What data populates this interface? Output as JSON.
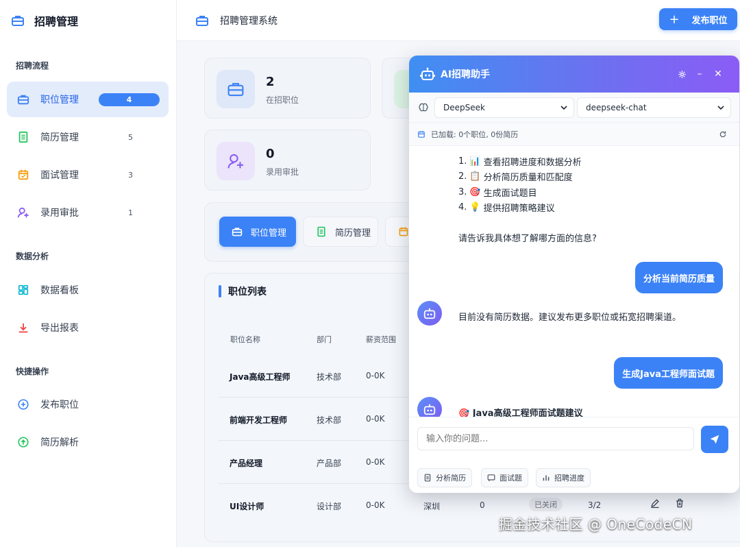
{
  "sidebar": {
    "brand": "招聘管理",
    "sections": [
      {
        "title": "招聘流程",
        "items": [
          {
            "label": "职位管理",
            "count": "4",
            "icon": "briefcase-icon"
          },
          {
            "label": "简历管理",
            "count": "5",
            "icon": "document-icon"
          },
          {
            "label": "面试管理",
            "count": "3",
            "icon": "calendar-icon"
          },
          {
            "label": "录用审批",
            "count": "1",
            "icon": "user-add-icon"
          }
        ]
      },
      {
        "title": "数据分析",
        "items": [
          {
            "label": "数据看板",
            "icon": "dashboard-icon"
          },
          {
            "label": "导出报表",
            "icon": "download-icon"
          }
        ]
      },
      {
        "title": "快捷操作",
        "items": [
          {
            "label": "发布职位",
            "icon": "plus-circle-icon"
          },
          {
            "label": "简历解析",
            "icon": "upload-cloud-icon"
          }
        ]
      }
    ]
  },
  "topbar": {
    "title": "招聘管理系统",
    "publish_label": "发布职位"
  },
  "stats": [
    {
      "value": "2",
      "label": "在招职位"
    },
    {
      "value": "0",
      "label": "录用审批"
    }
  ],
  "tabs": [
    "职位管理",
    "简历管理"
  ],
  "job_list": {
    "title": "职位列表",
    "headers": [
      "职位名称",
      "部门",
      "薪资范围"
    ],
    "rows": [
      {
        "name": "Java高级工程师",
        "dept": "技术部",
        "salary": "0-0K"
      },
      {
        "name": "前端开发工程师",
        "dept": "技术部",
        "salary": "0-0K"
      },
      {
        "name": "产品经理",
        "dept": "产品部",
        "salary": "0-0K"
      },
      {
        "name": "UI设计师",
        "dept": "设计部",
        "salary": "0-0K",
        "city": "深圳",
        "count": "0",
        "status": "已关闭",
        "progress": "3/2"
      }
    ]
  },
  "ai": {
    "title": "AI招聘助手",
    "provider": "DeepSeek",
    "model": "deepseek-chat",
    "status": "已加载: 0个职位, 0份简历",
    "list": [
      {
        "n": "1.",
        "emoji": "📊",
        "text": "查看招聘进度和数据分析"
      },
      {
        "n": "2.",
        "emoji": "📋",
        "text": "分析简历质量和匹配度"
      },
      {
        "n": "3.",
        "emoji": "🎯",
        "text": "生成面试题目"
      },
      {
        "n": "4.",
        "emoji": "💡",
        "text": "提供招聘策略建议"
      }
    ],
    "prompt_text": "请告诉我具体想了解哪方面的信息?",
    "user_msg_1": "分析当前简历质量",
    "bot_msg_1": "目前没有简历数据。建议发布更多职位或拓宽招聘渠道。",
    "user_msg_2": "生成Java工程师面试题",
    "bot_msg_2": "🎯 Java高级工程师面试题建议",
    "input_placeholder": "输入你的问题...",
    "quick_actions": [
      "分析简历",
      "面试题",
      "招聘进度"
    ]
  },
  "watermark": "掘金技术社区 @ OneCodeCN"
}
